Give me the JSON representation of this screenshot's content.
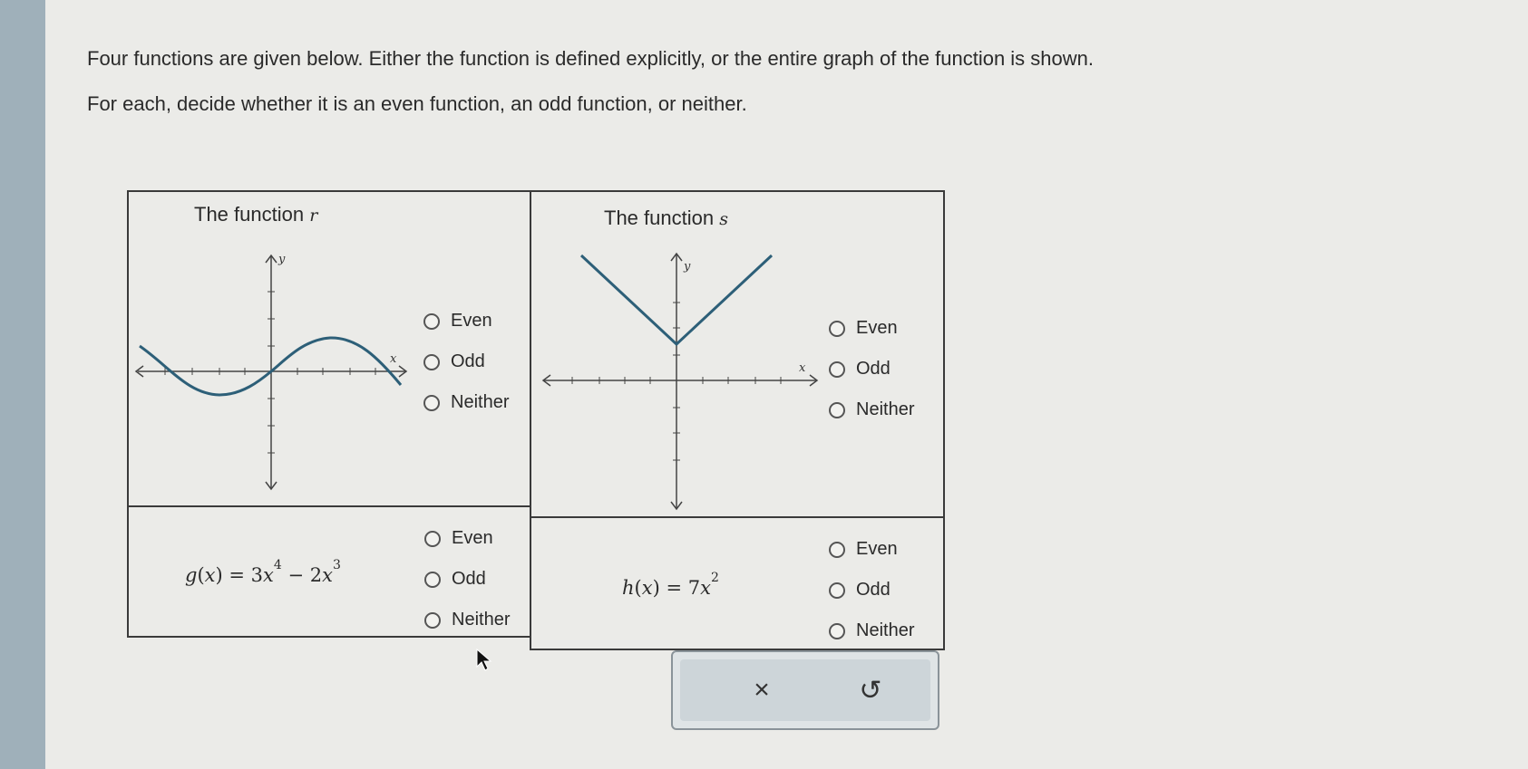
{
  "instructions": {
    "line1": "Four functions are given below. Either the function is defined explicitly, or the entire graph of the function is shown.",
    "line2": "For each, decide whether it is an even function, an odd function, or neither."
  },
  "cells": {
    "r": {
      "title": "The function ",
      "name": "r",
      "axis_x": "x",
      "axis_y": "y",
      "options": [
        "Even",
        "Odd",
        "Neither"
      ]
    },
    "s": {
      "title": "The function ",
      "name": "s",
      "axis_x": "x",
      "axis_y": "y",
      "options": [
        "Even",
        "Odd",
        "Neither"
      ]
    },
    "g": {
      "fn": "g",
      "var": "x",
      "eq": "= 3",
      "var2": "x",
      "exp1": "4",
      "minus": " − 2",
      "var3": "x",
      "exp2": "3",
      "options": [
        "Even",
        "Odd",
        "Neither"
      ]
    },
    "h": {
      "fn": "h",
      "var": "x",
      "eq": "= 7",
      "var2": "x",
      "exp1": "2",
      "options": [
        "Even",
        "Odd",
        "Neither"
      ]
    }
  },
  "actions": {
    "clear_symbol": "×",
    "undo_symbol": "↺"
  }
}
